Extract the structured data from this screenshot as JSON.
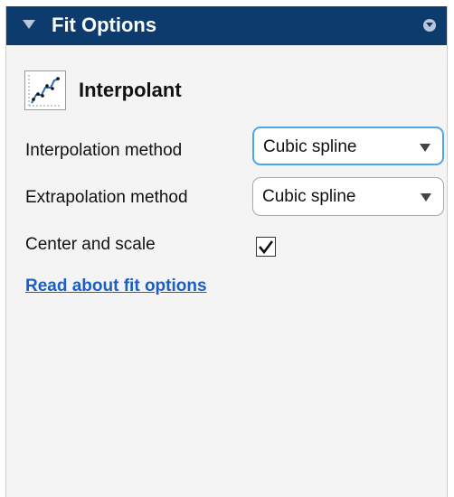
{
  "panel": {
    "title": "Fit Options",
    "accent_color": "#0d3b6e"
  },
  "fit_type": {
    "name": "Interpolant",
    "icon": "interpolant-fit-icon"
  },
  "options": {
    "interpolation_method": {
      "label": "Interpolation method",
      "value": "Cubic spline"
    },
    "extrapolation_method": {
      "label": "Extrapolation method",
      "value": "Cubic spline"
    },
    "center_and_scale": {
      "label": "Center and scale",
      "checked": true
    }
  },
  "help_link": {
    "label": "Read about fit options",
    "color": "#1a5fc7"
  }
}
